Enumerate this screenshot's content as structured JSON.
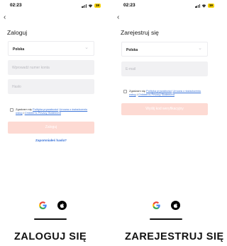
{
  "login": {
    "status_time": "02:23",
    "battery": "19",
    "back_icon": "chevron-left-icon",
    "title": "Zaloguj",
    "country": "Polska",
    "phone_placeholder": "Wprowadź numer konta",
    "password_placeholder": "Hasło",
    "consent_prefix": "Zgadzam się",
    "privacy_policy_link": "Polityka prywatności",
    "user_agreement_link": "Umowa o świadczeniu usług",
    "separator": "i",
    "children_privacy_link": "Children's Privacy Statement",
    "submit_label": "Zaloguj",
    "forgot_label": "Zapomniałeś hasła?"
  },
  "register": {
    "status_time": "02:23",
    "battery": "19",
    "back_icon": "chevron-left-icon",
    "title": "Zarejestruj się",
    "country": "Polska",
    "email_placeholder": "E-mail",
    "consent_prefix": "Zgadzam się",
    "privacy_policy_link": "Polityka prywatności",
    "user_agreement_link": "Umowa o świadczeniu usług",
    "separator": "i",
    "children_privacy_link": "Children's Privacy Statement",
    "submit_label": "Wyślij kod weryfikacyjny"
  },
  "social_icons": [
    "google-icon",
    "apple-icon"
  ],
  "colors": {
    "accent": "#fc6a4e",
    "button_disabled": "#fddad3",
    "link": "#3a73d8",
    "field_bg": "#f1f1f3",
    "battery": "#f5d000"
  },
  "captions": {
    "login": "ZALOGUJ SIĘ",
    "register": "ZAREJESTRUJ SIĘ"
  }
}
